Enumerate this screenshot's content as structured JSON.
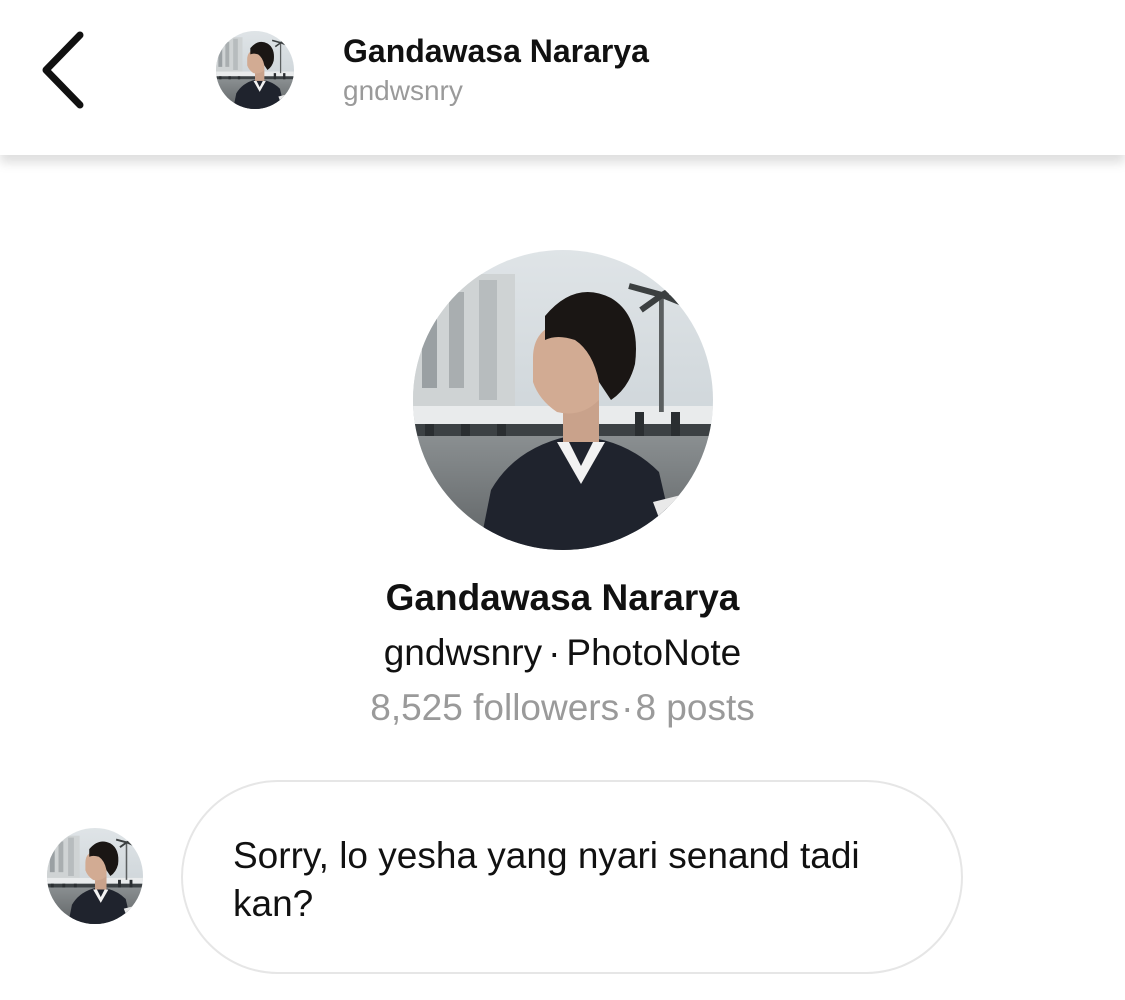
{
  "header": {
    "back_icon": "chevron-left-icon",
    "name": "Gandawasa Nararya",
    "handle": "gndwsnry"
  },
  "profile": {
    "name": "Gandawasa Nararya",
    "handle": "gndwsnry",
    "separator": "·",
    "app": "PhotoNote",
    "followers": "8,525 followers",
    "posts": "8 posts"
  },
  "messages": [
    {
      "text": "Sorry, lo yesha yang nyari senand tadi kan?"
    }
  ],
  "colors": {
    "primary_text": "#111111",
    "secondary_text": "#9a9a9a",
    "bubble_border": "#e6e6e6",
    "background": "#ffffff"
  }
}
